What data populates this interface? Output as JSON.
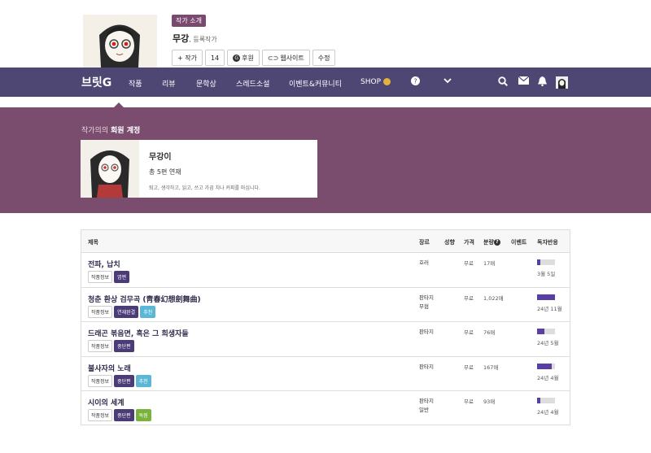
{
  "author": {
    "badge": "작가 소개",
    "name": "무강",
    "name_suffix": ", 등록작가",
    "buttons": {
      "follow": "+ 작가",
      "follow_count": "14",
      "sponsor": "후원",
      "website": "웹사이트",
      "edit": "수정"
    }
  },
  "nav": {
    "logo": "브릿G",
    "items": [
      "작품",
      "리뷰",
      "문학상",
      "스레드소설",
      "이벤트&커뮤니티",
      "SHOP"
    ],
    "icons": [
      "help-icon",
      "chevron-down-icon",
      "search-icon",
      "mail-icon",
      "bell-icon",
      "user-avatar"
    ],
    "bg": "#4f4773"
  },
  "member_section": {
    "title_prefix": "작가의",
    "title_bold": "회원 계정",
    "user": "무강이",
    "count": "총 5편 연재",
    "desc": "퇴고, 생각하고, 읽고, 쓰고 가끔 치나 커피를 마십니다.",
    "bg": "#7a4d6f"
  },
  "table": {
    "headers": [
      "제목",
      "장르",
      "성향",
      "가격",
      "분량",
      "이벤트",
      "독자반응"
    ],
    "rows": [
      {
        "title": "전파, 납치",
        "tags": [
          "작품정보",
          "엽편"
        ],
        "genre": "호러",
        "genre2": "",
        "price": "무료",
        "size": "17매",
        "reaction": 0.2,
        "date": "3월 5일"
      },
      {
        "title": "청춘 환상 검무곡 (靑春幻想劍舞曲)",
        "tags": [
          "작품정보",
          "연재완결",
          "추천"
        ],
        "genre": "판타지",
        "genre2": "무협",
        "price": "무료",
        "size": "1,022매",
        "reaction": 1.0,
        "date": "24년 11월"
      },
      {
        "title": "드래곤 볶음면, 혹은 그 희생자들",
        "tags": [
          "작품정보",
          "중단편"
        ],
        "genre": "판타지",
        "genre2": "",
        "price": "무료",
        "size": "76매",
        "reaction": 0.4,
        "date": "24년 5월"
      },
      {
        "title": "불사자의 노래",
        "tags": [
          "작품정보",
          "중단편",
          "추천"
        ],
        "genre": "판타지",
        "genre2": "",
        "price": "무료",
        "size": "167매",
        "reaction": 0.8,
        "date": "24년 4월"
      },
      {
        "title": "시이의 세계",
        "tags": [
          "작품정보",
          "중단편",
          "독점"
        ],
        "genre": "판타지",
        "genre2": "일반",
        "price": "무료",
        "size": "93매",
        "reaction": 0.2,
        "date": "24년 4월"
      }
    ]
  }
}
